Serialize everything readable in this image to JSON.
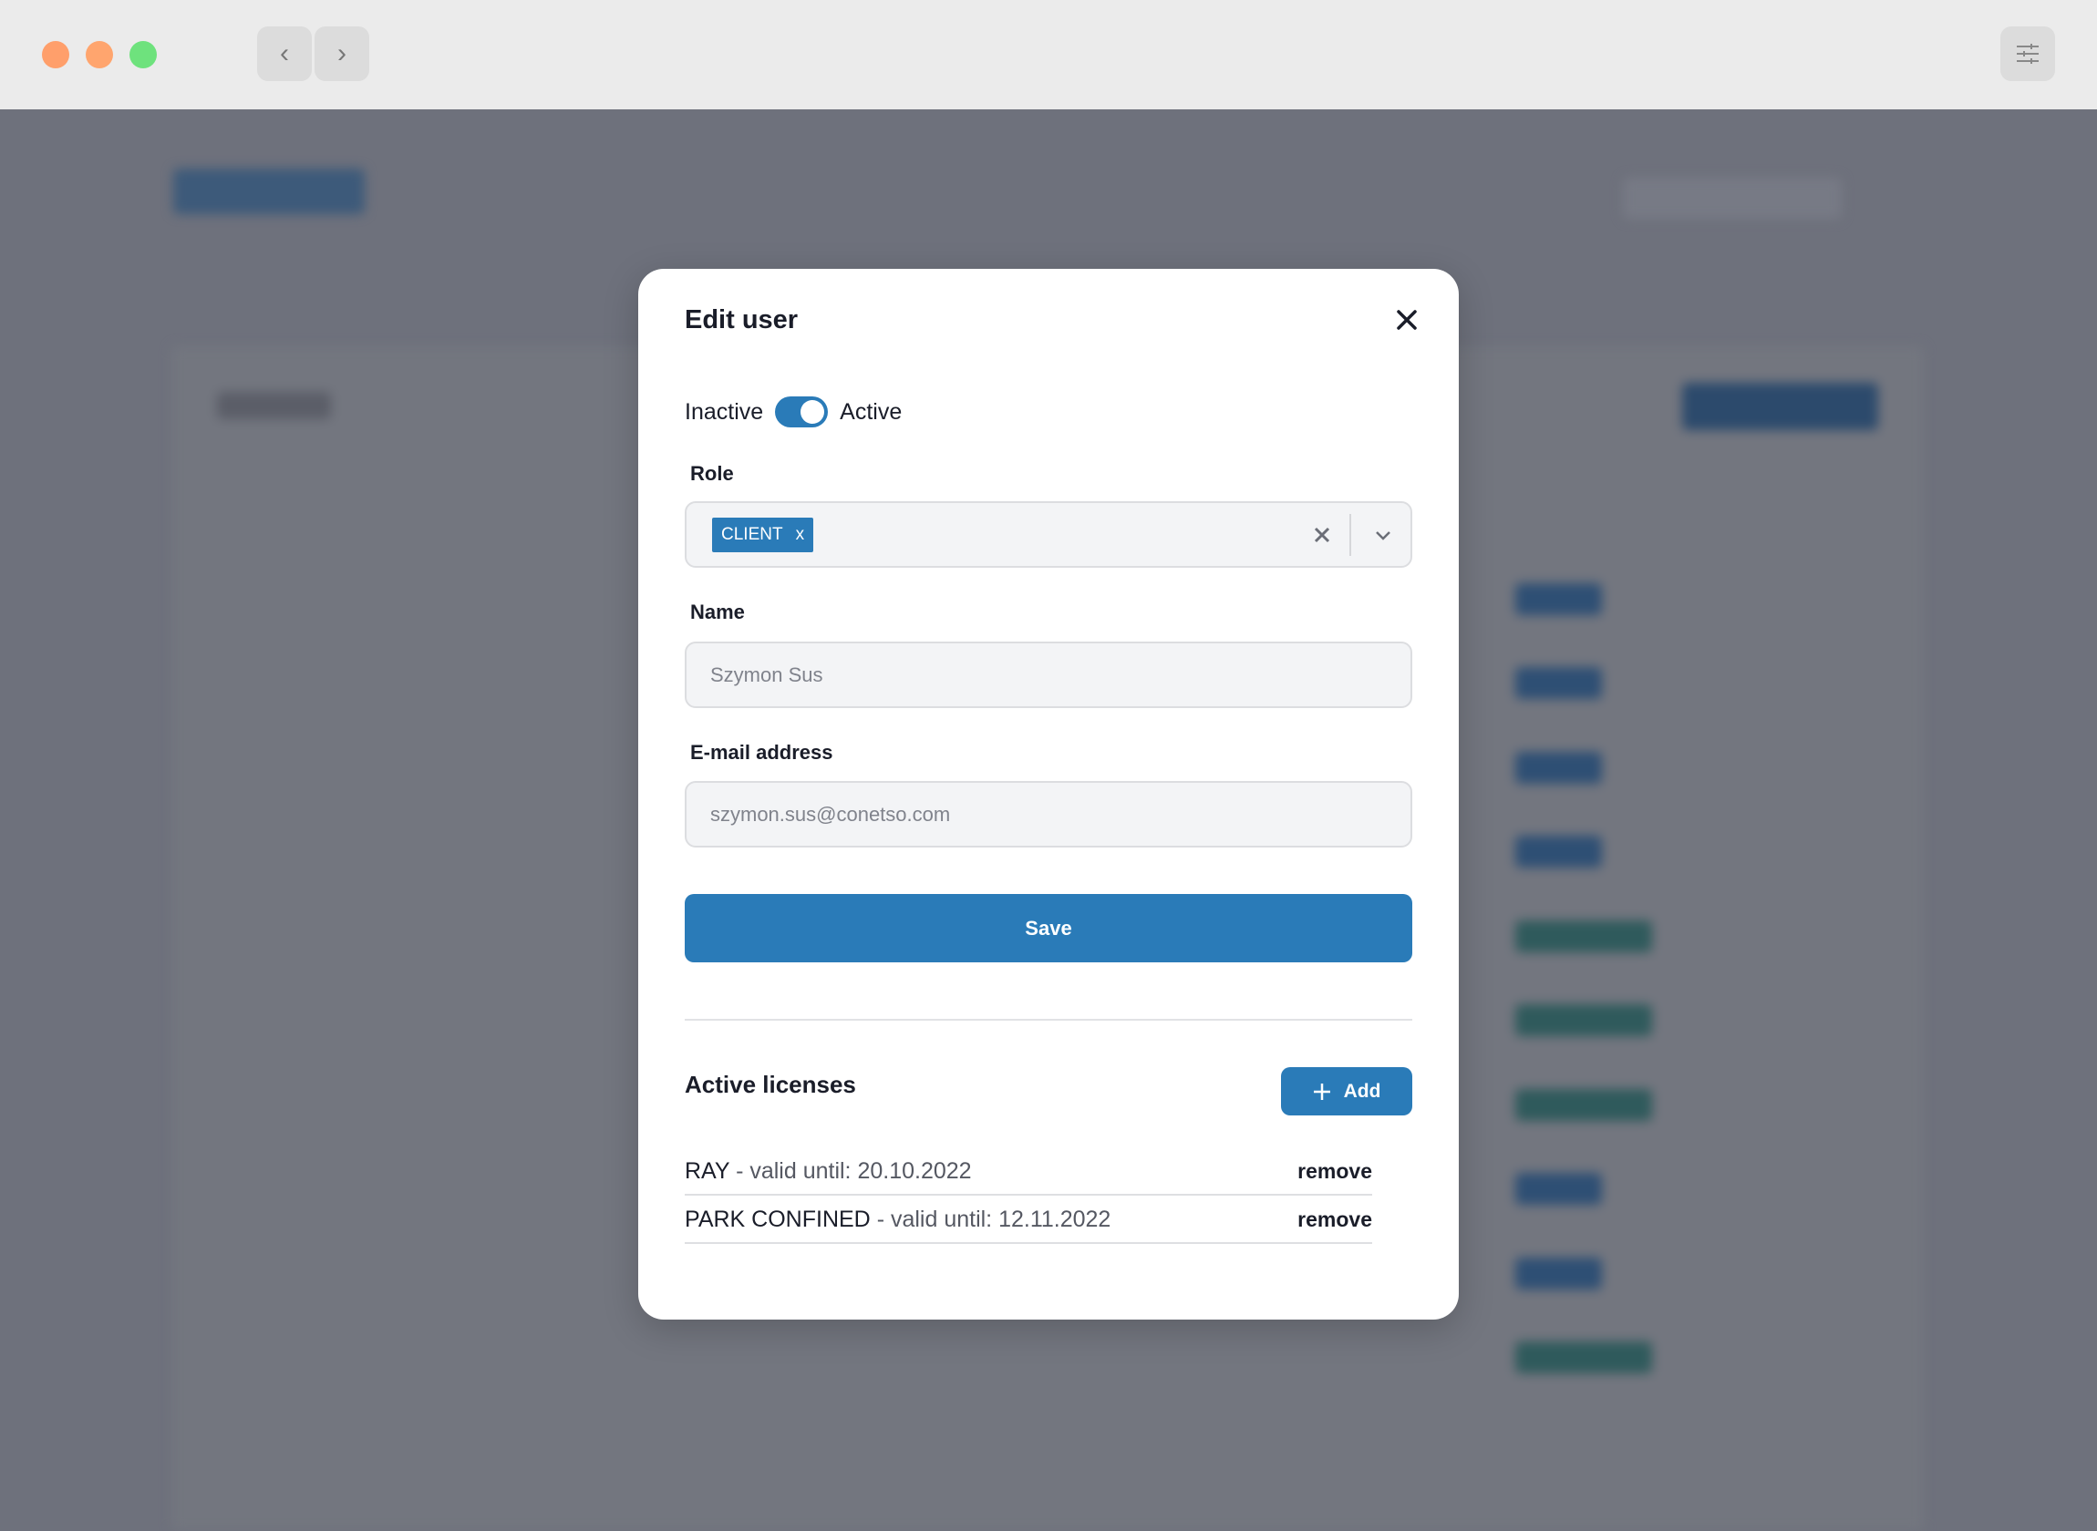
{
  "window": {
    "traffic_lights": [
      "#ff9f6b",
      "#ffa56e",
      "#6ee27d"
    ],
    "back_icon": "chevron-left-icon",
    "forward_icon": "chevron-right-icon",
    "settings_icon": "sliders-icon"
  },
  "modal": {
    "title": "Edit user",
    "close_icon": "close-icon",
    "status": {
      "inactive_label": "Inactive",
      "active_label": "Active",
      "is_active": true
    },
    "role": {
      "label": "Role",
      "selected": [
        "CLIENT"
      ],
      "chip_remove": "x"
    },
    "name": {
      "label": "Name",
      "value": "Szymon Sus"
    },
    "email": {
      "label": "E-mail address",
      "value": "szymon.sus@conetso.com"
    },
    "save_label": "Save",
    "licenses": {
      "title": "Active licenses",
      "add_label": "Add",
      "items": [
        {
          "name": "RAY",
          "validity": "- valid until: 20.10.2022",
          "action": "remove"
        },
        {
          "name": "PARK CONFINED",
          "validity": "- valid until: 12.11.2022",
          "action": "remove"
        }
      ]
    }
  },
  "colors": {
    "accent": "#2a7bb8",
    "overlay": "#6e717c"
  }
}
